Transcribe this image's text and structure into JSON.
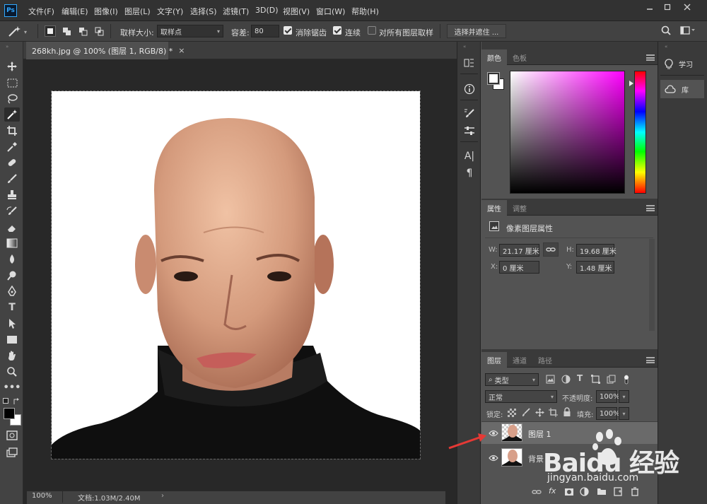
{
  "app": {
    "logo_text": "Ps"
  },
  "menu": [
    "文件(F)",
    "编辑(E)",
    "图像(I)",
    "图层(L)",
    "文字(Y)",
    "选择(S)",
    "滤镜(T)",
    "3D(D)",
    "视图(V)",
    "窗口(W)",
    "帮助(H)"
  ],
  "window_controls": [
    "minimize-icon",
    "restore-icon",
    "close-icon"
  ],
  "options": {
    "sample_size_label": "取样大小:",
    "sample_size_value": "取样点",
    "tolerance_label": "容差:",
    "tolerance_value": "80",
    "antialias_label": "消除锯齿",
    "antialias_checked": true,
    "contiguous_label": "连续",
    "contiguous_checked": true,
    "sample_all_label": "对所有图层取样",
    "sample_all_checked": false,
    "select_mask_label": "选择并遮住 ..."
  },
  "document": {
    "tab_title": "268kh.jpg @ 100% (图层 1, RGB/8) *",
    "zoom": "100%",
    "doc_info": "文档:1.03M/2.40M"
  },
  "tools": [
    "move-tool-icon",
    "marquee-tool-icon",
    "lasso-tool-icon",
    "magic-wand-tool-icon",
    "crop-tool-icon",
    "eyedropper-tool-icon",
    "healing-brush-tool-icon",
    "brush-tool-icon",
    "stamp-tool-icon",
    "history-brush-tool-icon",
    "eraser-tool-icon",
    "gradient-tool-icon",
    "blur-tool-icon",
    "dodge-tool-icon",
    "pen-tool-icon",
    "type-tool-icon",
    "path-selection-tool-icon",
    "rectangle-tool-icon",
    "hand-tool-icon",
    "zoom-tool-icon",
    "more-tools-icon"
  ],
  "color_panel": {
    "tabs": [
      "颜色",
      "色板"
    ],
    "active_tab": "颜色",
    "hue_color": "#ff00ff"
  },
  "properties_panel": {
    "tabs": [
      "属性",
      "调整"
    ],
    "active_tab": "属性",
    "section_title": "像素图层属性",
    "w_label": "W:",
    "w_value": "21.17 厘米",
    "h_label": "H:",
    "h_value": "19.68 厘米",
    "x_label": "X:",
    "x_value": "0 厘米",
    "y_label": "Y:",
    "y_value": "1.48 厘米"
  },
  "layers_panel": {
    "tabs": [
      "图层",
      "通道",
      "路径"
    ],
    "active_tab": "图层",
    "filter_label": "类型",
    "blend_mode": "正常",
    "opacity_label": "不透明度:",
    "opacity_value": "100%",
    "lock_label": "锁定:",
    "fill_label": "填充:",
    "fill_value": "100%",
    "layers": [
      {
        "name": "图层 1",
        "visible": true,
        "selected": true,
        "transparent": true
      },
      {
        "name": "背景",
        "visible": true,
        "selected": false,
        "transparent": false
      }
    ]
  },
  "learn": {
    "learn_label": "学习",
    "library_label": "库"
  },
  "watermark": {
    "text": "Baidu 经验",
    "url": "jingyan.baidu.com"
  },
  "annotation": {
    "arrow_color": "#e53935"
  },
  "colors": {
    "accent": "#31a8ff",
    "skin": "#e0a98a",
    "shirt": "#0f0f0f"
  }
}
